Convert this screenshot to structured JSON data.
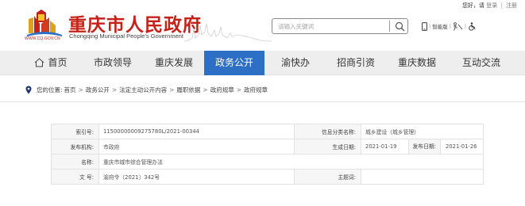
{
  "top_links": {
    "greeting": "您好，请",
    "login": "登录",
    "register": "注册",
    "separator": "|"
  },
  "site": {
    "title": "重庆市人民政府",
    "subtitle": "Chongqing Municipal People's Government",
    "url": "WWW.CQ.GOV.CN",
    "logo_color": "#c62119"
  },
  "search": {
    "placeholder": "请输入关键词"
  },
  "tools": {
    "accessible_label": "智能版",
    "separator": "|"
  },
  "nav": {
    "active_color": "#2d6fc4",
    "items": [
      {
        "label": "首页",
        "icon": "home-icon"
      },
      {
        "label": "市政领导"
      },
      {
        "label": "重庆发展"
      },
      {
        "label": "政务公开",
        "active": true
      },
      {
        "label": "渝快办"
      },
      {
        "label": "招商引资"
      },
      {
        "label": "重庆数据"
      },
      {
        "label": "互动交流"
      }
    ]
  },
  "breadcrumb": {
    "prefix": "您的位置:",
    "items": [
      "首页",
      "政务公开",
      "法定主动公开内容",
      "履职依据",
      "政府规章",
      "政府规章"
    ],
    "separator": ">"
  },
  "info": {
    "index_label": "索引号:",
    "index_value": "11500000009275780L/2021-00344",
    "category_label": "信息分类名称:",
    "category_value": "城乡建设（城乡管理）",
    "publisher_label": "发布机构:",
    "publisher_value": "市政府",
    "created_label": "生成日期:",
    "created_value": "2021-01-19",
    "published_label": "发布日期:",
    "published_value": "2021-01-26",
    "name_label": "名称:",
    "name_value": "重庆市城市综合管理办法",
    "docno_label": "文 号:",
    "docno_value": "渝府令〔2021〕342号",
    "subject_label": "主题词:",
    "subject_value": ""
  }
}
